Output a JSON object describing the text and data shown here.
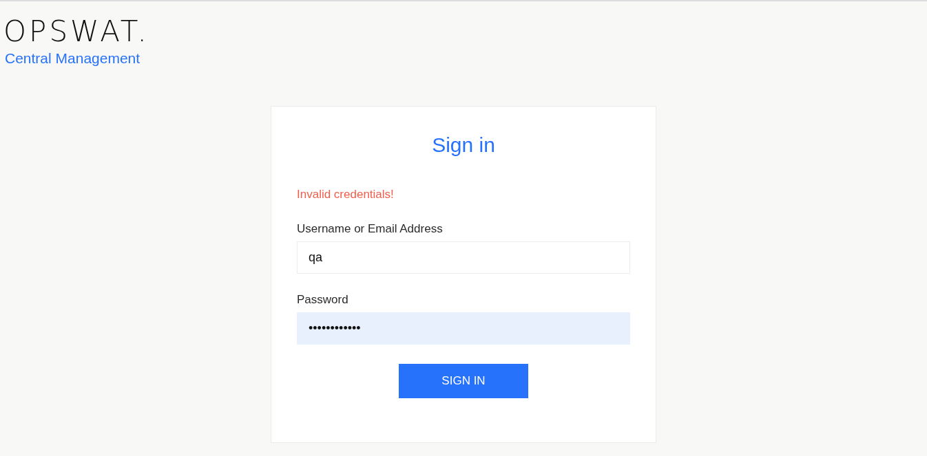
{
  "brand": {
    "logo": "OPSWAT.",
    "subtitle": "Central Management"
  },
  "form": {
    "title": "Sign in",
    "error": "Invalid credentials!",
    "fields": [
      {
        "label": "Username or Email Address",
        "value": "qa",
        "autofilled": false
      },
      {
        "label": "Password",
        "value": "••••••••••••",
        "autofilled": true
      }
    ],
    "button": "SIGN IN"
  }
}
